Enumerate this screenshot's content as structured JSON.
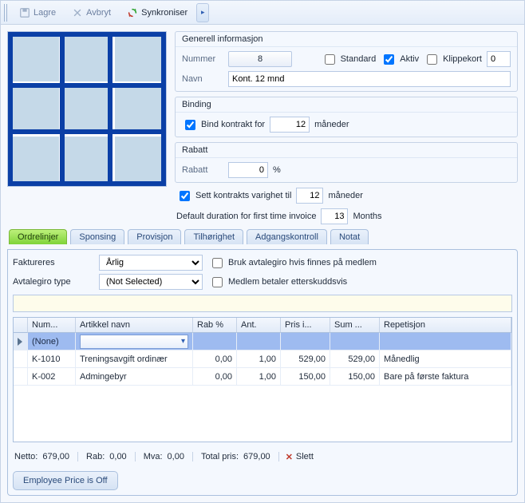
{
  "toolbar": {
    "save": "Lagre",
    "cancel": "Avbryt",
    "sync": "Synkroniser"
  },
  "general": {
    "group_title": "Generell informasjon",
    "number_label": "Nummer",
    "number_value": "8",
    "standard_label": "Standard",
    "standard_checked": false,
    "active_label": "Aktiv",
    "active_checked": true,
    "clipcard_label": "Klippekort",
    "clipcard_value": "0",
    "name_label": "Navn",
    "name_value": "Kont. 12 mnd"
  },
  "binding": {
    "group_title": "Binding",
    "bind_checked": true,
    "bind_label": "Bind kontrakt for",
    "bind_value": "12",
    "bind_unit": "måneder"
  },
  "discount": {
    "group_title": "Rabatt",
    "label": "Rabatt",
    "value": "0",
    "unit": "%"
  },
  "duration": {
    "set_checked": true,
    "set_label": "Sett kontrakts varighet til",
    "set_value": "12",
    "set_unit": "måneder",
    "default_label": "Default duration for first time invoice",
    "default_value": "13",
    "default_unit": "Months"
  },
  "tabs": {
    "order_lines": "Ordrelinjer",
    "sponsing": "Sponsing",
    "provision": "Provisjon",
    "belonging": "Tilhørighet",
    "access": "Adgangskontroll",
    "notes": "Notat"
  },
  "filters": {
    "invoiced_label": "Faktureres",
    "invoiced_value": "Årlig",
    "avtalegiro_label": "Avtalegiro type",
    "avtalegiro_value": "(Not Selected)",
    "use_avtalegiro_label": "Bruk avtalegiro hvis finnes på medlem",
    "use_avtalegiro_checked": false,
    "member_pays_arrears_label": "Medlem betaler etterskuddsvis",
    "member_pays_arrears_checked": false
  },
  "grid": {
    "headers": {
      "num": "Num...",
      "name": "Artikkel navn",
      "discount": "Rab %",
      "qty": "Ant.",
      "price": "Pris i...",
      "sum": "Sum ...",
      "repeat": "Repetisjon"
    },
    "new_row_placeholder": "(None)",
    "rows": [
      {
        "num": "K-1010",
        "name": "Treningsavgift ordinær",
        "discount": "0,00",
        "qty": "1,00",
        "price": "529,00",
        "sum": "529,00",
        "repeat": "Månedlig"
      },
      {
        "num": "K-002",
        "name": "Admingebyr",
        "discount": "0,00",
        "qty": "1,00",
        "price": "150,00",
        "sum": "150,00",
        "repeat": "Bare på første faktura"
      }
    ]
  },
  "totals": {
    "net_label": "Netto:",
    "net_value": "679,00",
    "discount_label": "Rab:",
    "discount_value": "0,00",
    "vat_label": "Mva:",
    "vat_value": "0,00",
    "total_label": "Total pris:",
    "total_value": "679,00",
    "delete_label": "Slett"
  },
  "employee_price_btn": "Employee Price is Off"
}
